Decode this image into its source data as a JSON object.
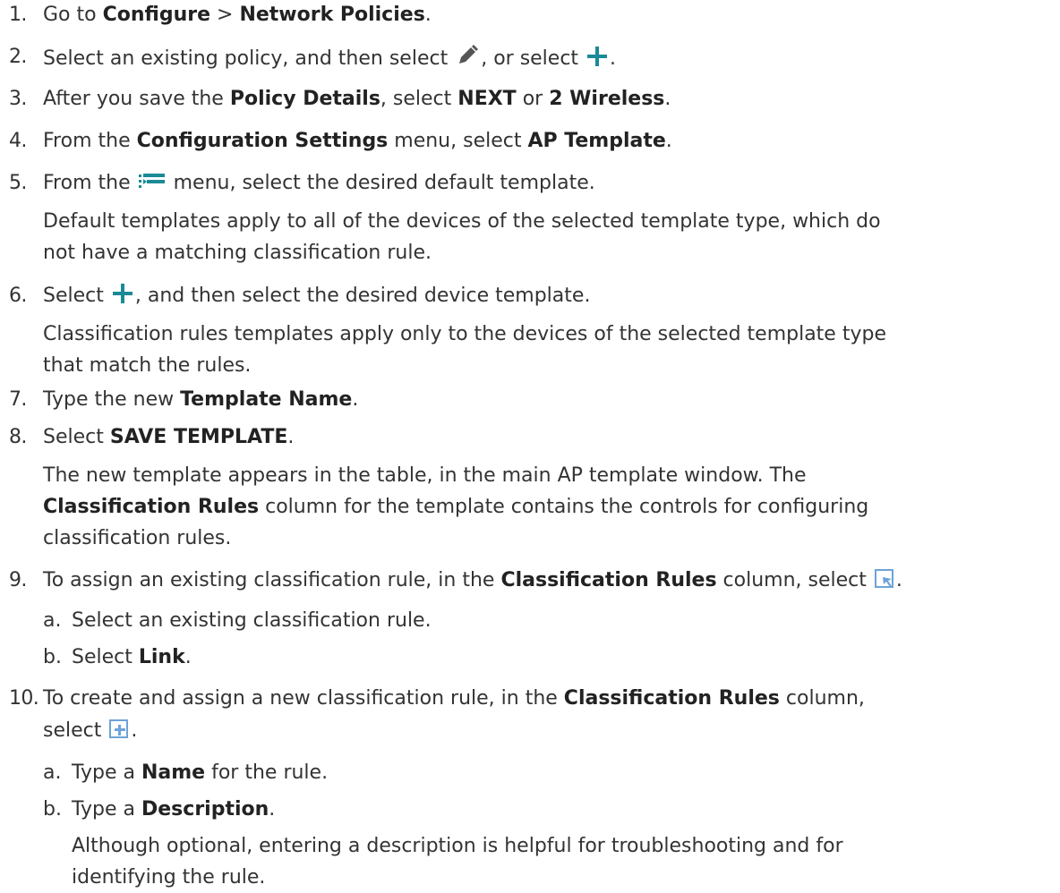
{
  "colors": {
    "text": "#333333",
    "teal": "#1b8a96",
    "pencil": "#555555",
    "blueicon": "#6ea3d8"
  },
  "icons": {
    "edit": "pencil-icon",
    "add": "plus-icon",
    "template_menu": "list-menu-icon",
    "link_rule": "link-rule-icon",
    "new_rule": "add-rule-icon"
  },
  "steps": [
    {
      "num": "1.",
      "t": [
        "Go to ",
        "Configure",
        " > ",
        "Network Policies",
        "."
      ]
    },
    {
      "num": "2.",
      "t": [
        "Select an existing policy, and then select ",
        ", or select ",
        "."
      ]
    },
    {
      "num": "3.",
      "t": [
        "After you save the ",
        "Policy Details",
        ", select ",
        "NEXT",
        " or ",
        "2 Wireless",
        "."
      ]
    },
    {
      "num": "4.",
      "t": [
        "From the ",
        "Configuration Settings",
        " menu, select ",
        "AP Template",
        "."
      ]
    },
    {
      "num": "5.",
      "t": [
        "From the ",
        " menu, select the desired default template."
      ],
      "para": [
        "Default templates apply to all of the devices of the selected template type, which do",
        "not have a matching classification rule."
      ]
    },
    {
      "num": "6.",
      "t": [
        "Select ",
        ", and then select the desired device template."
      ],
      "para": [
        "Classification rules templates apply only to the devices of the selected template type",
        "that match the rules."
      ]
    },
    {
      "num": "7.",
      "t": [
        "Type the new ",
        "Template Name",
        "."
      ]
    },
    {
      "num": "8.",
      "t": [
        "Select ",
        "SAVE TEMPLATE",
        "."
      ],
      "para": [
        "The new template appears in the table, in the main AP template window. The",
        "Classification Rules",
        " column for the template contains the controls for configuring",
        "classification rules."
      ]
    },
    {
      "num": "9.",
      "t": [
        "To assign an existing classification rule, in the ",
        "Classification Rules",
        " column, select ",
        "."
      ],
      "subs": [
        {
          "label": "a.",
          "t": [
            "Select an existing classification rule."
          ]
        },
        {
          "label": "b.",
          "t": [
            "Select ",
            "Link",
            "."
          ]
        }
      ]
    },
    {
      "num": "10.",
      "t": [
        "To create and assign a new classification rule, in the ",
        "Classification Rules",
        " column,",
        "select ",
        "."
      ],
      "subs": [
        {
          "label": "a.",
          "t": [
            "Type a ",
            "Name",
            " for the rule."
          ]
        },
        {
          "label": "b.",
          "t": [
            "Type a ",
            "Description",
            "."
          ],
          "para": [
            "Although optional, entering a description is helpful for troubleshooting and for",
            "identifying the rule."
          ]
        }
      ]
    }
  ]
}
